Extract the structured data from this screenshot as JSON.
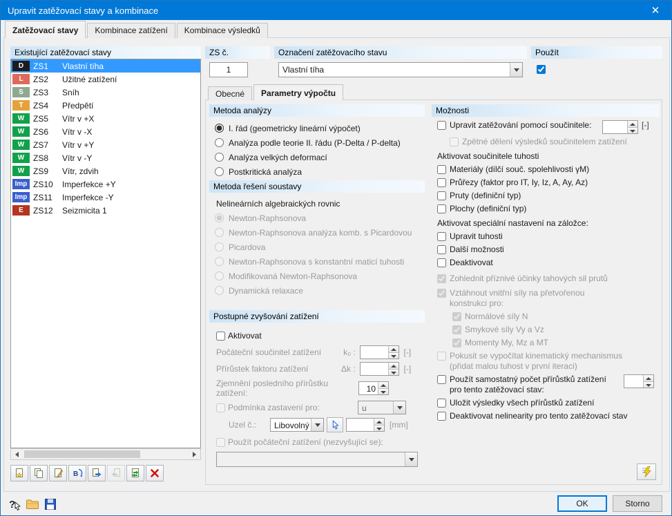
{
  "window": {
    "title": "Upravit zatěžovací stavy a kombinace"
  },
  "icons": {
    "close": "✕"
  },
  "colors": {
    "titlebar": "#0078d7",
    "selection": "#3399ff",
    "accent": "#0078d7"
  },
  "main_tabs": [
    "Zatěžovací stavy",
    "Kombinace zatížení",
    "Kombinace výsledků"
  ],
  "sub_tabs": [
    "Obecné",
    "Parametry výpočtu"
  ],
  "load_cases": {
    "header": "Existující zatěžovací stavy",
    "items": [
      {
        "badge": "D",
        "badge_color": "#1c1c1c",
        "id": "ZS1",
        "name": "Vlastní tíha",
        "selected": true
      },
      {
        "badge": "L",
        "badge_color": "#e06a5a",
        "id": "ZS2",
        "name": "Užitné zatížení",
        "selected": false
      },
      {
        "badge": "S",
        "badge_color": "#8fa98f",
        "id": "ZS3",
        "name": "Sníh",
        "selected": false
      },
      {
        "badge": "T",
        "badge_color": "#e3a33a",
        "id": "ZS4",
        "name": "Předpětí",
        "selected": false
      },
      {
        "badge": "W",
        "badge_color": "#12a14b",
        "id": "ZS5",
        "name": "Vítr v +X",
        "selected": false
      },
      {
        "badge": "W",
        "badge_color": "#12a14b",
        "id": "ZS6",
        "name": "Vítr v -X",
        "selected": false
      },
      {
        "badge": "W",
        "badge_color": "#12a14b",
        "id": "ZS7",
        "name": "Vítr v +Y",
        "selected": false
      },
      {
        "badge": "W",
        "badge_color": "#12a14b",
        "id": "ZS8",
        "name": "Vítr v -Y",
        "selected": false
      },
      {
        "badge": "W",
        "badge_color": "#12a14b",
        "id": "ZS9",
        "name": "Vítr, zdvih",
        "selected": false
      },
      {
        "badge": "Imp",
        "badge_color": "#3a5fcd",
        "id": "ZS10",
        "name": "Imperfekce +Y",
        "selected": false
      },
      {
        "badge": "Imp",
        "badge_color": "#3a5fcd",
        "id": "ZS11",
        "name": "Imperfekce -Y",
        "selected": false
      },
      {
        "badge": "E",
        "badge_color": "#b5351f",
        "id": "ZS12",
        "name": "Seizmicita 1",
        "selected": false
      }
    ]
  },
  "header_fields": {
    "number": {
      "label": "ZS č.",
      "value": "1"
    },
    "designation": {
      "label": "Označení zatěžovacího stavu",
      "value": "Vlastní tíha"
    },
    "use": {
      "label": "Použít",
      "checked": true
    }
  },
  "analysis_method": {
    "header": "Metoda analýzy",
    "options": [
      "I. řád (geometricky lineární výpočet)",
      "Analýza podle teorie II. řádu (P-Delta / P-delta)",
      "Analýza velkých deformací",
      "Postkritická analýza"
    ],
    "selected_index": 0,
    "disabled": false
  },
  "solver_method": {
    "header": "Metoda řešení soustavy",
    "subheader": "Nelineárních algebraických rovnic",
    "options": [
      "Newton-Raphsonova",
      "Newton-Raphsonova analýza komb. s Picardovou",
      "Picardova",
      "Newton-Raphsonova s konstantní maticí tuhosti",
      "Modifikovaná Newton-Raphsonova",
      "Dynamická relaxace"
    ],
    "selected_index": 0,
    "disabled": true
  },
  "incremental": {
    "header": "Postupné zvyšování zatížení",
    "activate": {
      "label": "Aktivovat",
      "checked": false
    },
    "initial_factor": {
      "label": "Počáteční součinitel zatížení",
      "symbol": "k₀ :",
      "value": "",
      "unit": "[-]"
    },
    "increment": {
      "label": "Přírůstek faktoru zatížení",
      "symbol": "Δk :",
      "value": "",
      "unit": "[-]"
    },
    "refinement": {
      "label": "Zjemnění posledního přírůstku zatížení:",
      "value": "10"
    },
    "stop_condition": {
      "label": "Podmínka zastavení pro:",
      "checked": false,
      "value": "u"
    },
    "node": {
      "label": "Uzel č.:",
      "value": "Libovolný",
      "field_value": "",
      "unit": "[mm]"
    },
    "initial_load": {
      "label": "Použít počáteční zatížení (nezvyšující se):",
      "checked": false,
      "value": ""
    }
  },
  "options": {
    "header": "Možnosti",
    "modify_loading": {
      "label": "Upravit zatěžování pomocí součinitele:",
      "checked": false,
      "value": "",
      "unit": "[-]"
    },
    "divide_results": {
      "label": "Zpětné dělení výsledků součinitelem zatížení",
      "checked": false,
      "disabled": true
    },
    "stiffness_header": "Aktivovat součinitele tuhosti",
    "materials": {
      "label": "Materiály (dílčí souč. spolehlivosti γM)",
      "checked": false
    },
    "sections": {
      "label": "Průřezy (faktor pro IT, Iy, Iz, A, Ay, Az)",
      "checked": false
    },
    "members": {
      "label": "Pruty (definiční typ)",
      "checked": false
    },
    "surfaces": {
      "label": "Plochy (definiční typ)",
      "checked": false
    },
    "special_header": "Aktivovat speciální nastavení na záložce:",
    "modify_stiffness": {
      "label": "Upravit tuhosti",
      "checked": false
    },
    "extra_options": {
      "label": "Další možnosti",
      "checked": false
    },
    "deactivate": {
      "label": "Deaktivovat",
      "checked": false
    },
    "tension_effects": {
      "label": "Zohlednit příznivé účinky tahových sil prutů",
      "checked": true,
      "disabled": true
    },
    "internal_forces": {
      "label": "Vztáhnout vnitřní síly na přetvořenou konstrukci pro:",
      "checked": true,
      "disabled": true
    },
    "normal_forces": {
      "label": "Normálové síly N",
      "checked": true,
      "disabled": true
    },
    "shear_forces": {
      "label": "Smykové síly Vy a Vz",
      "checked": true,
      "disabled": true
    },
    "moments": {
      "label": "Momenty My, Mz a MT",
      "checked": true,
      "disabled": true
    },
    "kinematic": {
      "label": "Pokusit se vypočítat kinematický mechanismus (přidat malou tuhost v první iteraci)",
      "checked": false,
      "disabled": true
    },
    "separate_increments": {
      "label": "Použít samostatný počet přírůstků zatížení pro tento zatěžovací stav:",
      "checked": false,
      "value": ""
    },
    "save_results": {
      "label": "Uložit výsledky všech přírůstků zatížení",
      "checked": false
    },
    "deactivate_nonlinearities": {
      "label": "Deaktivovat nelinearity pro tento zatěžovací stav",
      "checked": false
    }
  },
  "footer": {
    "ok": "OK",
    "cancel": "Storno"
  }
}
